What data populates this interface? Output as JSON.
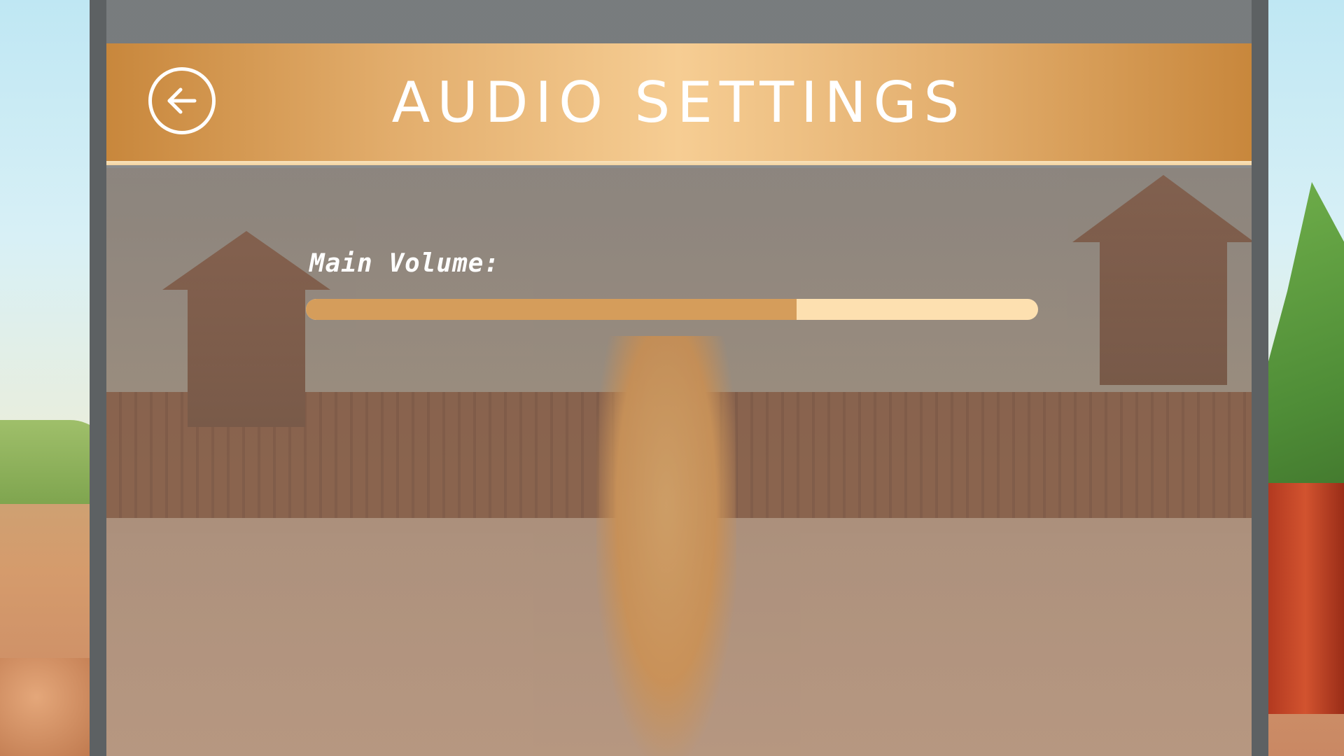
{
  "screen": {
    "title": "AUDIO SETTINGS",
    "back_icon": "arrow-left-circle-icon"
  },
  "volume": {
    "label": "Main Volume:",
    "level_fraction": 0.67
  },
  "colors": {
    "banner_gold": "#e2ad6c",
    "slider_fill": "#d59d5b",
    "slider_track": "#fde0b0",
    "panel_gray": "#787c7e"
  }
}
